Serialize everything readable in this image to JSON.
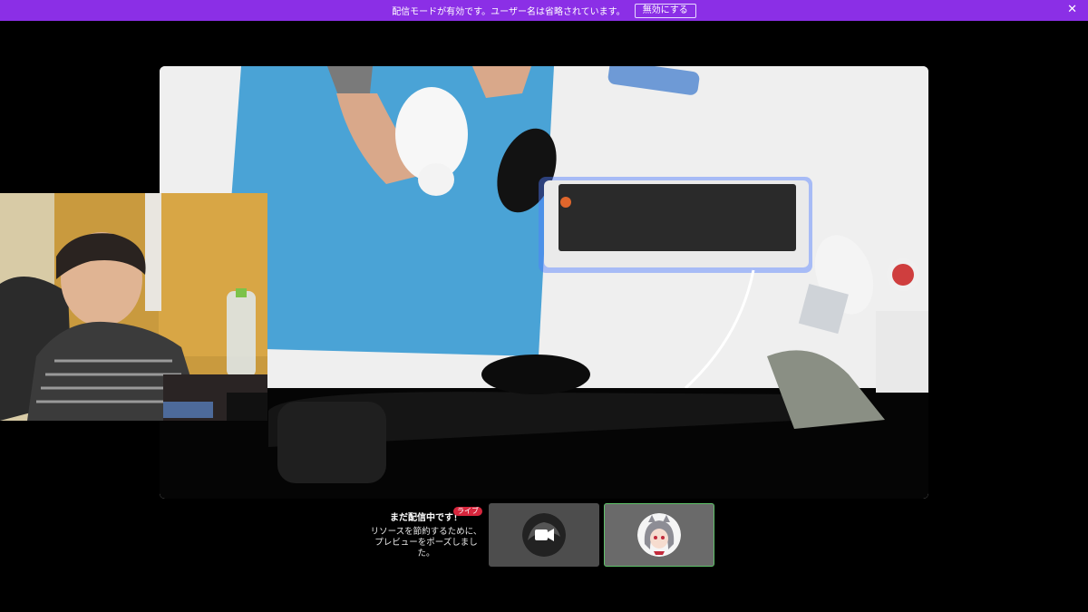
{
  "banner": {
    "message": "配信モードが有効です。ユーザー名は省略されています。",
    "disable_label": "無効にする",
    "close_glyph": "✕"
  },
  "stream_status": {
    "title": "まだ配信中です！",
    "live_badge": "ライブ",
    "description": "リソースを節約するために、プレビューをポーズしました。"
  },
  "colors": {
    "banner": "#8b2fe6",
    "live_badge": "#d7263d",
    "active_tile_border": "#5fc36a"
  },
  "participants": [
    {
      "icon": "video-camera-icon",
      "active": false
    },
    {
      "icon": "avatar-anime-icon",
      "active": true
    }
  ]
}
